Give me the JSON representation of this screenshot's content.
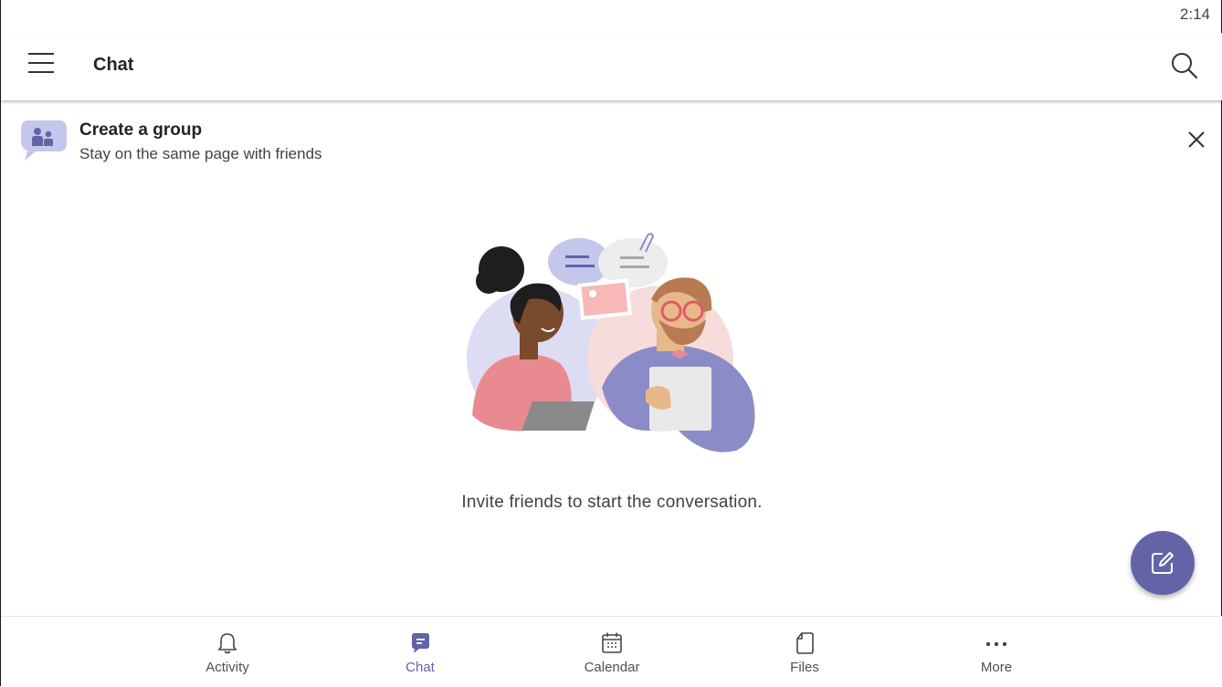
{
  "status_bar": {
    "time": "2:14"
  },
  "app_bar": {
    "title": "Chat",
    "menu_icon": "hamburger-menu-icon",
    "search_icon": "search-icon"
  },
  "banner": {
    "title": "Create a group",
    "subtitle": "Stay on the same page with friends",
    "icon": "group-chat-icon",
    "close_icon": "close-icon"
  },
  "empty_state": {
    "message": "Invite friends to start the conversation.",
    "illustration": "two-people-chatting-illustration"
  },
  "fab": {
    "icon": "compose-icon",
    "color": "#6264a7"
  },
  "bottom_nav": {
    "items": [
      {
        "label": "Activity",
        "icon": "bell-icon",
        "active": false
      },
      {
        "label": "Chat",
        "icon": "chat-icon",
        "active": true
      },
      {
        "label": "Calendar",
        "icon": "calendar-icon",
        "active": false
      },
      {
        "label": "Files",
        "icon": "file-icon",
        "active": false
      },
      {
        "label": "More",
        "icon": "more-dots-icon",
        "active": false
      }
    ]
  },
  "colors": {
    "accent": "#6264a7",
    "text": "#242424",
    "muted": "#505050"
  }
}
